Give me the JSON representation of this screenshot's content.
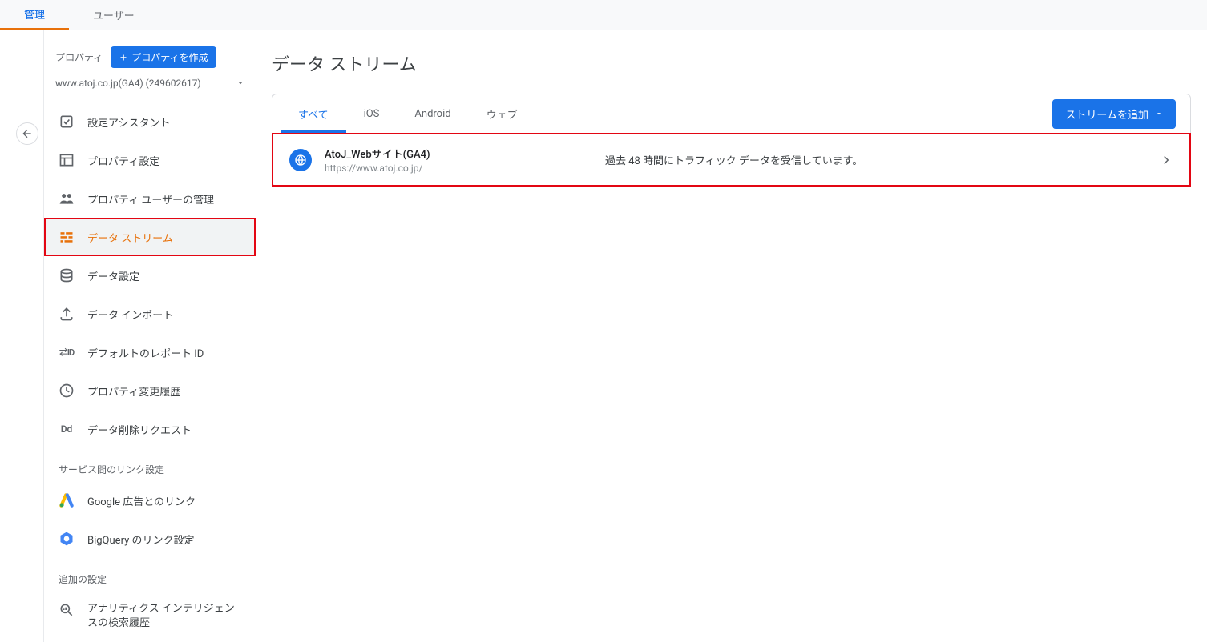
{
  "topnav": {
    "tabs": [
      "管理",
      "ユーザー"
    ]
  },
  "sidebar": {
    "property_label": "プロパティ",
    "create_button": "プロパティを作成",
    "selected_property": "www.atoj.co.jp(GA4) (249602617)",
    "items": [
      {
        "label": "設定アシスタント",
        "icon": "check"
      },
      {
        "label": "プロパティ設定",
        "icon": "panel"
      },
      {
        "label": "プロパティ ユーザーの管理",
        "icon": "users"
      },
      {
        "label": "データ ストリーム",
        "icon": "stream",
        "active": true
      },
      {
        "label": "データ設定",
        "icon": "db"
      },
      {
        "label": "データ インポート",
        "icon": "upload"
      },
      {
        "label": "デフォルトのレポート ID",
        "icon": "id"
      },
      {
        "label": "プロパティ変更履歴",
        "icon": "history"
      },
      {
        "label": "データ削除リクエスト",
        "icon": "dd"
      }
    ],
    "section_links_label": "サービス間のリンク設定",
    "links": [
      {
        "label": "Google 広告とのリンク",
        "icon": "ads"
      },
      {
        "label": "BigQuery のリンク設定",
        "icon": "bq"
      }
    ],
    "section_additional_label": "追加の設定",
    "additional": [
      {
        "label": "アナリティクス インテリジェンスの検索履歴",
        "icon": "search"
      }
    ]
  },
  "main": {
    "title": "データ ストリーム",
    "tabs": [
      "すべて",
      "iOS",
      "Android",
      "ウェブ"
    ],
    "add_button": "ストリームを追加",
    "stream": {
      "name": "AtoJ_Webサイト(GA4)",
      "url": "https://www.atoj.co.jp/",
      "status": "過去 48 時間にトラフィック データを受信しています。"
    }
  }
}
